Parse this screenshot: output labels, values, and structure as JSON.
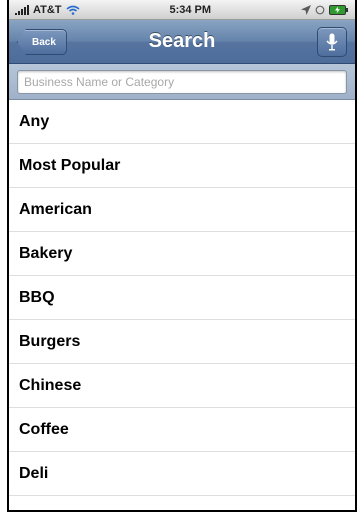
{
  "statusbar": {
    "carrier": "AT&T",
    "time": "5:34 PM"
  },
  "navbar": {
    "back_label": "Back",
    "title": "Search"
  },
  "search": {
    "placeholder": "Business Name or Category",
    "value": ""
  },
  "categories": [
    "Any",
    "Most Popular",
    "American",
    "Bakery",
    "BBQ",
    "Burgers",
    "Chinese",
    "Coffee",
    "Deli"
  ],
  "colors": {
    "nav_bar": "#5774a0",
    "search_bar": "#aebdd2",
    "accent_green": "#2f9a2f"
  }
}
